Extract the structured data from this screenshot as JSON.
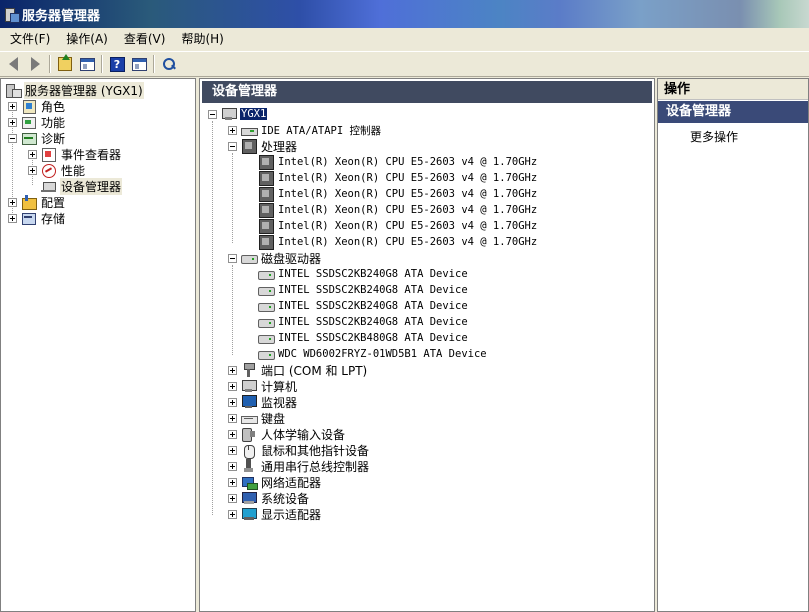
{
  "window": {
    "title": "服务器管理器"
  },
  "menu": [
    {
      "label": "文件(F)"
    },
    {
      "label": "操作(A)"
    },
    {
      "label": "查看(V)"
    },
    {
      "label": "帮助(H)"
    }
  ],
  "left_tree": {
    "root": "服务器管理器 (YGX1)",
    "roles": "角色",
    "features": "功能",
    "diagnostics": "诊断",
    "event_viewer": "事件查看器",
    "performance": "性能",
    "device_manager": "设备管理器",
    "configuration": "配置",
    "storage": "存储"
  },
  "main": {
    "header": "设备管理器",
    "computer": "YGX1",
    "ide": "IDE ATA/ATAPI 控制器",
    "processors": "处理器",
    "cpus": [
      "Intel(R) Xeon(R) CPU E5-2603 v4 @ 1.70GHz",
      "Intel(R) Xeon(R) CPU E5-2603 v4 @ 1.70GHz",
      "Intel(R) Xeon(R) CPU E5-2603 v4 @ 1.70GHz",
      "Intel(R) Xeon(R) CPU E5-2603 v4 @ 1.70GHz",
      "Intel(R) Xeon(R) CPU E5-2603 v4 @ 1.70GHz",
      "Intel(R) Xeon(R) CPU E5-2603 v4 @ 1.70GHz"
    ],
    "disk_drives": "磁盘驱动器",
    "disks": [
      "INTEL SSDSC2KB240G8 ATA Device",
      "INTEL SSDSC2KB240G8 ATA Device",
      "INTEL SSDSC2KB240G8 ATA Device",
      "INTEL SSDSC2KB240G8 ATA Device",
      "INTEL SSDSC2KB480G8 ATA Device",
      "WDC WD6002FRYZ-01WD5B1 ATA Device"
    ],
    "ports": "端口 (COM 和 LPT)",
    "computer_cat": "计算机",
    "monitors": "监视器",
    "keyboards": "键盘",
    "hid": "人体学输入设备",
    "mice": "鼠标和其他指针设备",
    "usb": "通用串行总线控制器",
    "network": "网络适配器",
    "system": "系统设备",
    "display": "显示适配器"
  },
  "actions": {
    "header": "操作",
    "section": "设备管理器",
    "more": "更多操作"
  }
}
